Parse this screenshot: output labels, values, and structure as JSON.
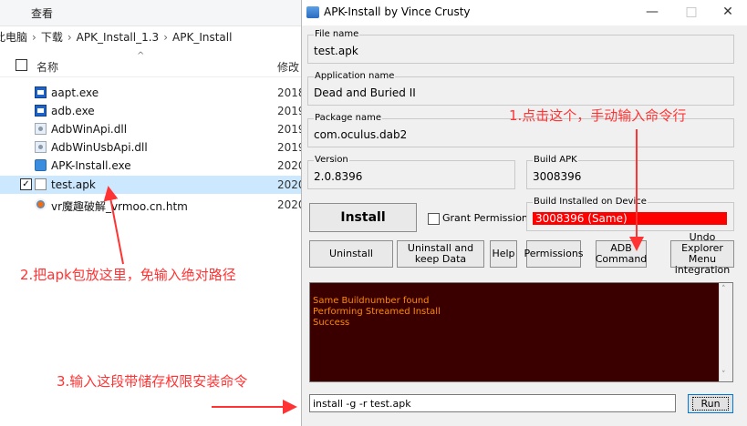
{
  "explorer": {
    "ribbon_tab": "查看",
    "breadcrumb": [
      "此电脑",
      "下载",
      "APK_Install_1.3",
      "APK_Install"
    ],
    "columns": {
      "name": "名称",
      "modified": "修改"
    },
    "files": [
      {
        "name": "aapt.exe",
        "date": "2018",
        "icon": "exe-icon",
        "selected": false
      },
      {
        "name": "adb.exe",
        "date": "2019",
        "icon": "exe-icon",
        "selected": false
      },
      {
        "name": "AdbWinApi.dll",
        "date": "2019",
        "icon": "dll-icon",
        "selected": false
      },
      {
        "name": "AdbWinUsbApi.dll",
        "date": "2019",
        "icon": "dll-icon",
        "selected": false
      },
      {
        "name": "APK-Install.exe",
        "date": "2020",
        "icon": "setup-icon",
        "selected": false
      },
      {
        "name": "test.apk",
        "date": "2020",
        "icon": "file-icon",
        "selected": true
      },
      {
        "name": "vr魔趣破解_vrmoo.cn.htm",
        "date": "2020",
        "icon": "htm-icon",
        "selected": false
      }
    ]
  },
  "app": {
    "title": "APK-Install by Vince Crusty",
    "window_controls": {
      "minimize": "—",
      "maximize": "□",
      "close": "✕"
    },
    "file_name": {
      "label": "File name",
      "value": "test.apk"
    },
    "application_name": {
      "label": "Application name",
      "value": "Dead and Buried II"
    },
    "package_name": {
      "label": "Package name",
      "value": "com.oculus.dab2"
    },
    "version": {
      "label": "Version",
      "value": "2.0.8396"
    },
    "build_apk": {
      "label": "Build APK",
      "value": "3008396"
    },
    "build_installed": {
      "label": "Build Installed on Device",
      "value": "3008396 (Same)"
    },
    "install_button": "Install",
    "grant_permissions": "Grant Permissions",
    "buttons": {
      "uninstall": "Uninstall",
      "uninstall_keep_data": "Uninstall and keep Data",
      "help": "Help",
      "permissions": "Permissions",
      "adb_command": "ADB Command",
      "undo_explorer": "Undo Explorer Menu integration"
    },
    "console_lines": [
      "Same Buildnumber found",
      "Performing Streamed Install",
      "Success"
    ],
    "command_input": "install -g -r test.apk",
    "run_button": "Run"
  },
  "annotations": {
    "step1": "1.点击这个，手动输入命令行",
    "step2": "2.把apk包放这里，免输入绝对路径",
    "step3": "3.输入这段带储存权限安装命令"
  },
  "colors": {
    "annotation": "#ff3333",
    "console_bg": "#3a0000",
    "console_text": "#ff8a00",
    "build_installed_bg": "#ff0000"
  }
}
